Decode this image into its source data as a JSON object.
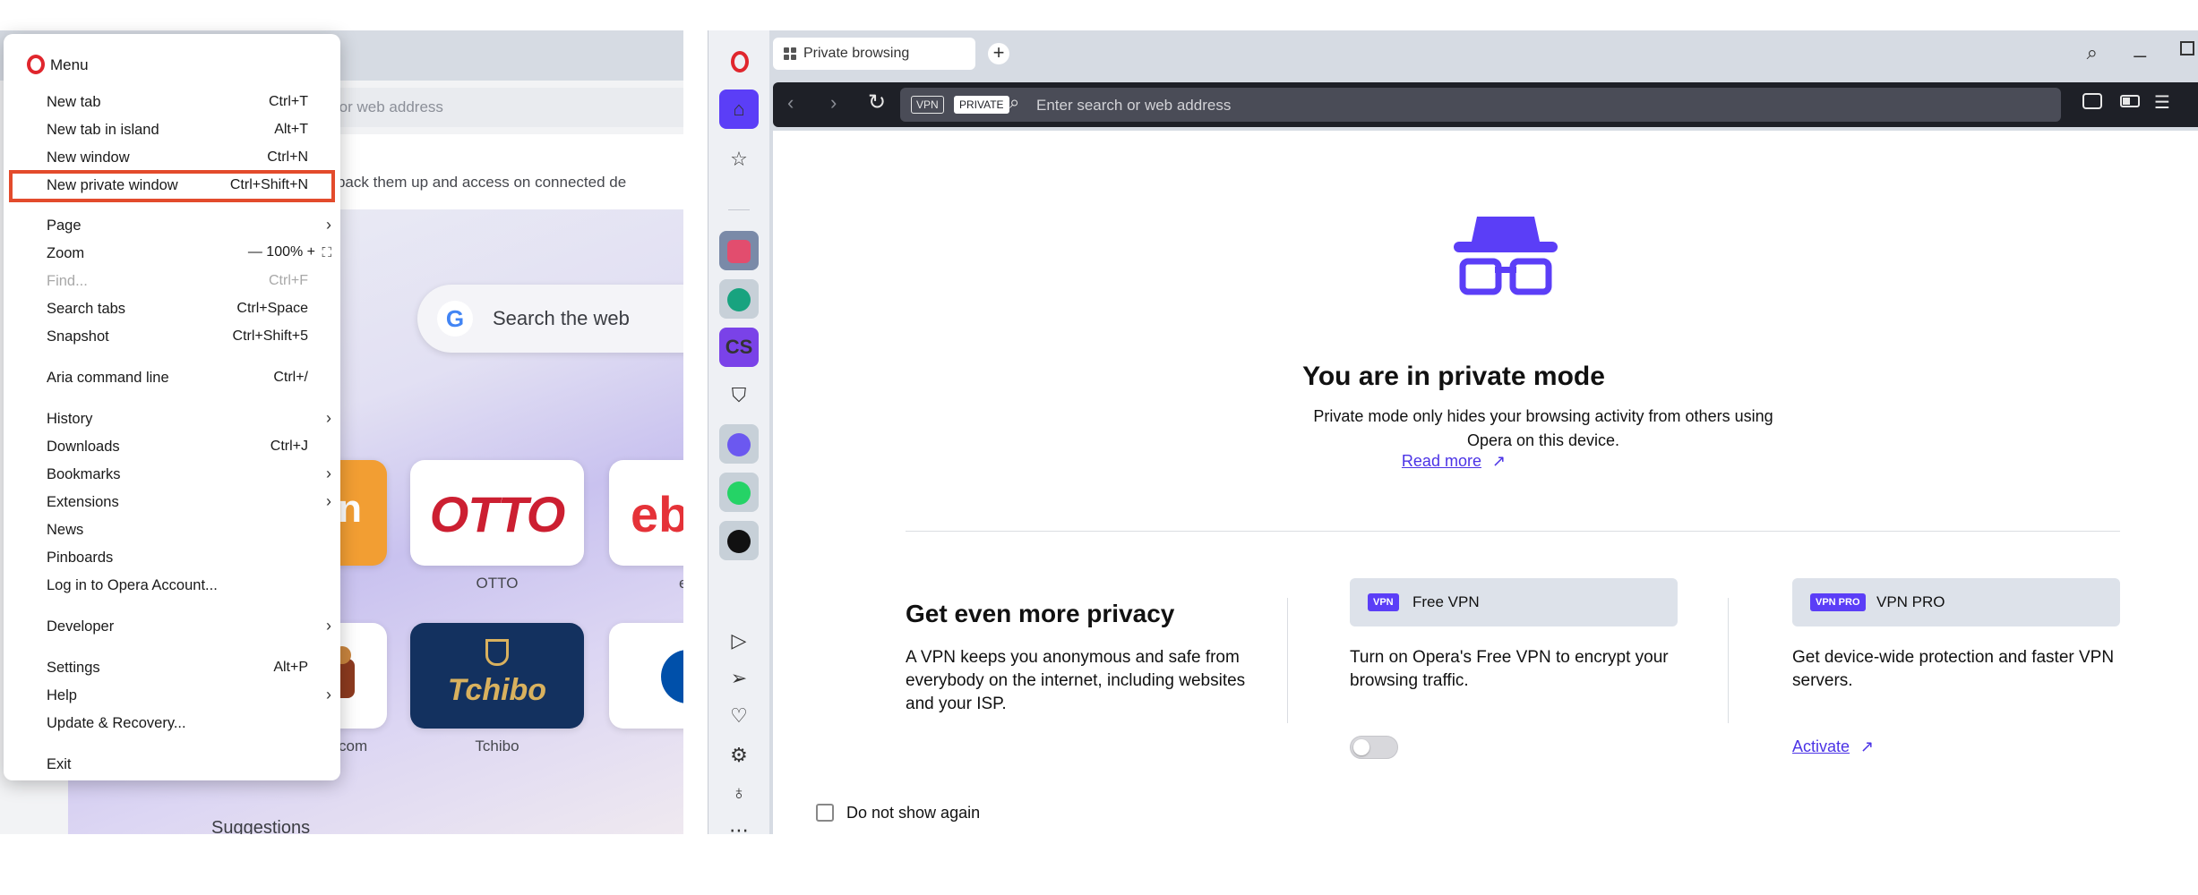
{
  "menu": {
    "title": "Menu",
    "items": [
      {
        "label": "New tab",
        "shortcut": "Ctrl+T"
      },
      {
        "label": "New tab in island",
        "shortcut": "Alt+T"
      },
      {
        "label": "New window",
        "shortcut": "Ctrl+N"
      },
      {
        "label": "New private window",
        "shortcut": "Ctrl+Shift+N"
      },
      {
        "label": "Page",
        "shortcut": ""
      },
      {
        "label": "Zoom",
        "shortcut": "— 100% +"
      },
      {
        "label": "Find...",
        "shortcut": "Ctrl+F"
      },
      {
        "label": "Search tabs",
        "shortcut": "Ctrl+Space"
      },
      {
        "label": "Snapshot",
        "shortcut": "Ctrl+Shift+5"
      },
      {
        "label": "Aria command line",
        "shortcut": "Ctrl+/"
      },
      {
        "label": "History",
        "shortcut": ""
      },
      {
        "label": "Downloads",
        "shortcut": "Ctrl+J"
      },
      {
        "label": "Bookmarks",
        "shortcut": ""
      },
      {
        "label": "Extensions",
        "shortcut": ""
      },
      {
        "label": "News",
        "shortcut": ""
      },
      {
        "label": "Pinboards",
        "shortcut": ""
      },
      {
        "label": "Log in to Opera Account...",
        "shortcut": ""
      },
      {
        "label": "Developer",
        "shortcut": ""
      },
      {
        "label": "Settings",
        "shortcut": "Alt+P"
      },
      {
        "label": "Help",
        "shortcut": ""
      },
      {
        "label": "Update & Recovery...",
        "shortcut": ""
      },
      {
        "label": "Exit",
        "shortcut": ""
      }
    ]
  },
  "left_window": {
    "address_placeholder": "ch or web address",
    "sync_text": "sswords to back them up and access on connected de",
    "search_text": "Search the web",
    "google_letter": "G",
    "amazon_letter": "n",
    "otto_logo": "OTTO",
    "otto_label": "OTTO",
    "ebay_logo": "eb",
    "ebay_label": "e",
    "booking_label": "com",
    "tchibo_logo": "Tchibo",
    "tchibo_label": "Tchibo",
    "suggestions": "Suggestions",
    "more": "..."
  },
  "right_window": {
    "tab_title": "Private browsing",
    "address_badge_vpn": "VPN",
    "address_badge_private": "PRIVATE",
    "address_placeholder": "Enter search or web address",
    "sidebar_cs": "CS",
    "private_title": "You are in private mode",
    "private_desc": "Private mode only hides your browsing activity from others using Opera on this device.",
    "read_more": "Read more",
    "more_title": "Get even more privacy",
    "more_desc": "A VPN keeps you anonymous and safe from everybody on the internet, including websites and your ISP.",
    "free_vpn_badge": "VPN",
    "free_vpn_label": "Free VPN",
    "free_vpn_desc": "Turn on Opera's Free VPN to encrypt your browsing traffic.",
    "vpn_pro_badge": "VPN PRO",
    "vpn_pro_label": "VPN PRO",
    "vpn_pro_desc": "Get device-wide protection and faster VPN servers.",
    "activate": "Activate",
    "do_not_show": "Do not show again",
    "accent_color": "#5b3ef7",
    "link_color": "#4b33e6"
  }
}
